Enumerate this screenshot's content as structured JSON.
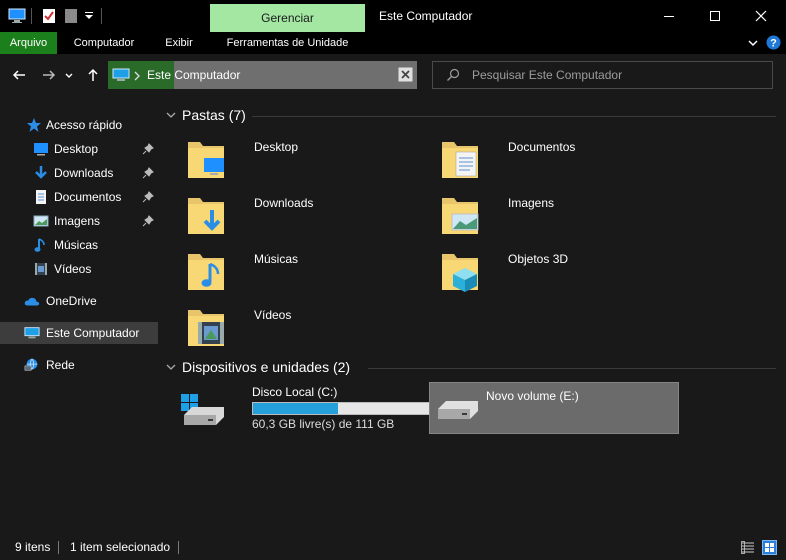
{
  "window": {
    "title": "Este Computador",
    "manage_tab": "Gerenciar"
  },
  "ribbon": {
    "tabs": [
      "Arquivo",
      "Computador",
      "Exibir",
      "Ferramentas de Unidade"
    ]
  },
  "address": {
    "path": "Este Computador",
    "search_placeholder": "Pesquisar Este Computador"
  },
  "sidebar": {
    "quick_access": "Acesso rápido",
    "items": [
      {
        "label": "Desktop",
        "icon": "desktop-icon",
        "pinned": true
      },
      {
        "label": "Downloads",
        "icon": "download-icon",
        "pinned": true
      },
      {
        "label": "Documentos",
        "icon": "document-icon",
        "pinned": true
      },
      {
        "label": "Imagens",
        "icon": "image-icon",
        "pinned": true
      },
      {
        "label": "Músicas",
        "icon": "music-icon",
        "pinned": false
      },
      {
        "label": "Vídeos",
        "icon": "video-icon",
        "pinned": false
      }
    ],
    "onedrive": "OneDrive",
    "this_pc": "Este Computador",
    "network": "Rede"
  },
  "main": {
    "folders_header": "Pastas (7)",
    "folders": [
      {
        "label": "Desktop",
        "overlay": "desktop"
      },
      {
        "label": "Documentos",
        "overlay": "document"
      },
      {
        "label": "Downloads",
        "overlay": "download"
      },
      {
        "label": "Imagens",
        "overlay": "image"
      },
      {
        "label": "Músicas",
        "overlay": "music"
      },
      {
        "label": "Objetos 3D",
        "overlay": "cube"
      },
      {
        "label": "Vídeos",
        "overlay": "video"
      }
    ],
    "devices_header": "Dispositivos e unidades (2)",
    "drives": [
      {
        "label": "Disco Local (C:)",
        "free": "60,3 GB livre(s) de 111 GB",
        "used_fraction": 0.457
      },
      {
        "label": "Novo volume (E:)"
      }
    ]
  },
  "status": {
    "items_count": "9 itens",
    "selected": "1 item selecionado"
  },
  "colors": {
    "manage_tab": "#a3e7a3",
    "file_tab": "#1b7f1b",
    "address_highlight": "#2a6b2a",
    "usage_bar": "#26a0da"
  }
}
